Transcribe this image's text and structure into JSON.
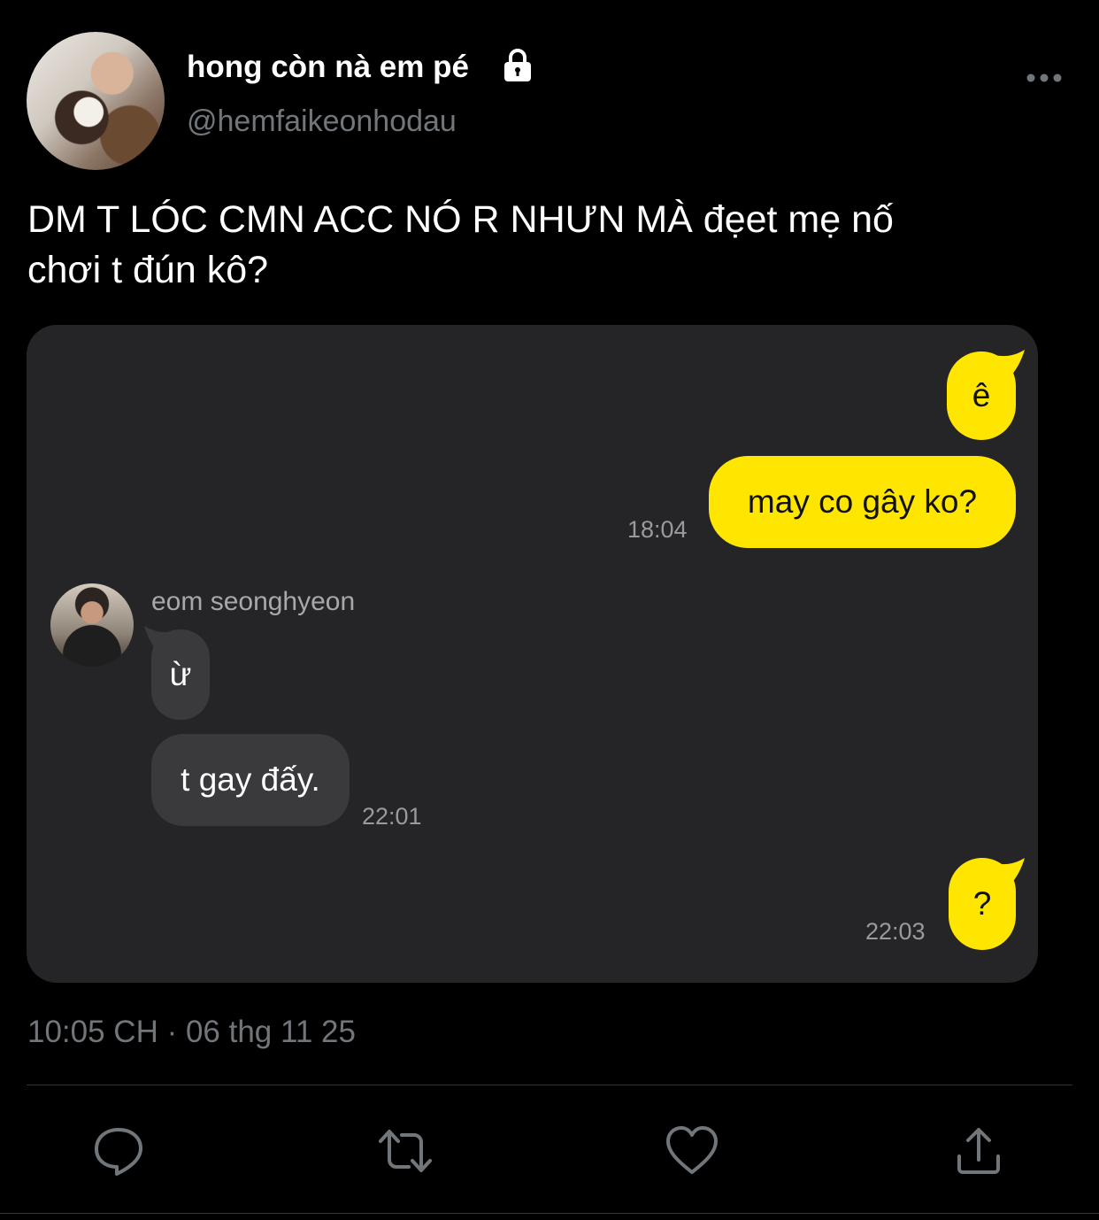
{
  "tweet": {
    "display_name": "hong còn nà em pé",
    "handle": "@hemfaikeonhodau",
    "text_line1": "DM T LÓC CMN ACC NÓ R NHƯN MÀ đẹet mẹ nố",
    "text_line2": "chơi t đún kô?",
    "timestamp": "10:05 CH · 06 thg 11 25",
    "icons": {
      "lock": "lock-icon",
      "more": "more-icon",
      "reply": "reply-icon",
      "retweet": "retweet-icon",
      "like": "heart-icon",
      "share": "share-icon"
    }
  },
  "chat": {
    "sender_name": "eom seonghyeon",
    "messages": [
      {
        "text": "ê",
        "side": "out"
      },
      {
        "text": "may co gây ko?",
        "side": "out",
        "time": "18:04"
      },
      {
        "text": "ừ",
        "side": "in"
      },
      {
        "text": "t gay đấy.",
        "side": "in",
        "time": "22:01"
      },
      {
        "text": "?",
        "side": "out",
        "time": "22:03"
      }
    ],
    "colors": {
      "outgoing": "#ffe600",
      "incoming": "#3a3a3d",
      "background": "#252528"
    }
  }
}
